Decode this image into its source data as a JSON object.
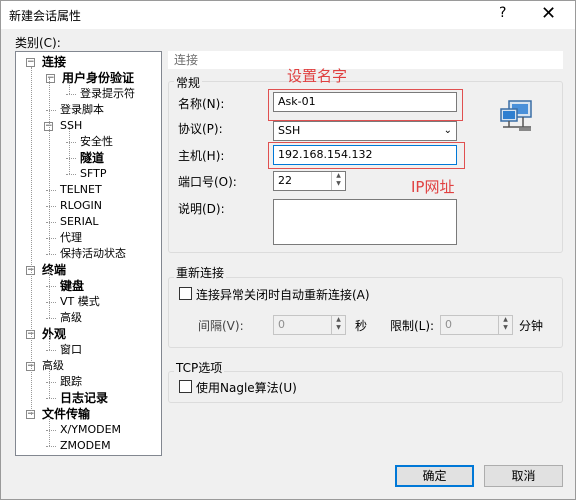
{
  "window": {
    "title": "新建会话属性",
    "help_glyph": "?",
    "close_glyph": "✕"
  },
  "category_label": "类别(C):",
  "tree": [
    {
      "label": "连接",
      "bold": true
    },
    {
      "label": "用户身份验证",
      "bold": true
    },
    {
      "label": "登录提示符",
      "bold": false
    },
    {
      "label": "登录脚本",
      "bold": false
    },
    {
      "label": "SSH",
      "bold": false
    },
    {
      "label": "安全性",
      "bold": false
    },
    {
      "label": "隧道",
      "bold": true
    },
    {
      "label": "SFTP",
      "bold": false
    },
    {
      "label": "TELNET",
      "bold": false
    },
    {
      "label": "RLOGIN",
      "bold": false
    },
    {
      "label": "SERIAL",
      "bold": false
    },
    {
      "label": "代理",
      "bold": false
    },
    {
      "label": "保持活动状态",
      "bold": false
    },
    {
      "label": "终端",
      "bold": true
    },
    {
      "label": "键盘",
      "bold": true
    },
    {
      "label": "VT 模式",
      "bold": false
    },
    {
      "label": "高级",
      "bold": false
    },
    {
      "label": "外观",
      "bold": true
    },
    {
      "label": "窗口",
      "bold": false
    },
    {
      "label": "高级",
      "bold": false
    },
    {
      "label": "跟踪",
      "bold": false
    },
    {
      "label": "日志记录",
      "bold": true
    },
    {
      "label": "文件传输",
      "bold": true
    },
    {
      "label": "X/YMODEM",
      "bold": false
    },
    {
      "label": "ZMODEM",
      "bold": false
    }
  ],
  "section_header": "连接",
  "general": {
    "title": "常规",
    "name_label": "名称(N):",
    "name_value": "Ask-01",
    "protocol_label": "协议(P):",
    "protocol_value": "SSH",
    "host_label": "主机(H):",
    "host_value": "192.168.154.132",
    "port_label": "端口号(O):",
    "port_value": "22",
    "desc_label": "说明(D):",
    "desc_value": ""
  },
  "reconnect": {
    "title": "重新连接",
    "auto_label": "连接异常关闭时自动重新连接(A)",
    "auto_checked": false,
    "interval_label": "间隔(V):",
    "interval_value": "0",
    "interval_unit": "秒",
    "limit_label": "限制(L):",
    "limit_value": "0",
    "limit_unit": "分钟"
  },
  "tcp": {
    "title": "TCP选项",
    "nagle_label": "使用Nagle算法(U)",
    "nagle_checked": false
  },
  "annotations": {
    "name_note": "设置名字",
    "ip_note": "IP网址",
    "color": "#e04040"
  },
  "buttons": {
    "ok": "确定",
    "cancel": "取消"
  },
  "icons": {
    "session": "network-computer-icon",
    "spin": "spin-arrows-icon",
    "dropdown": "chevron-down-icon"
  }
}
